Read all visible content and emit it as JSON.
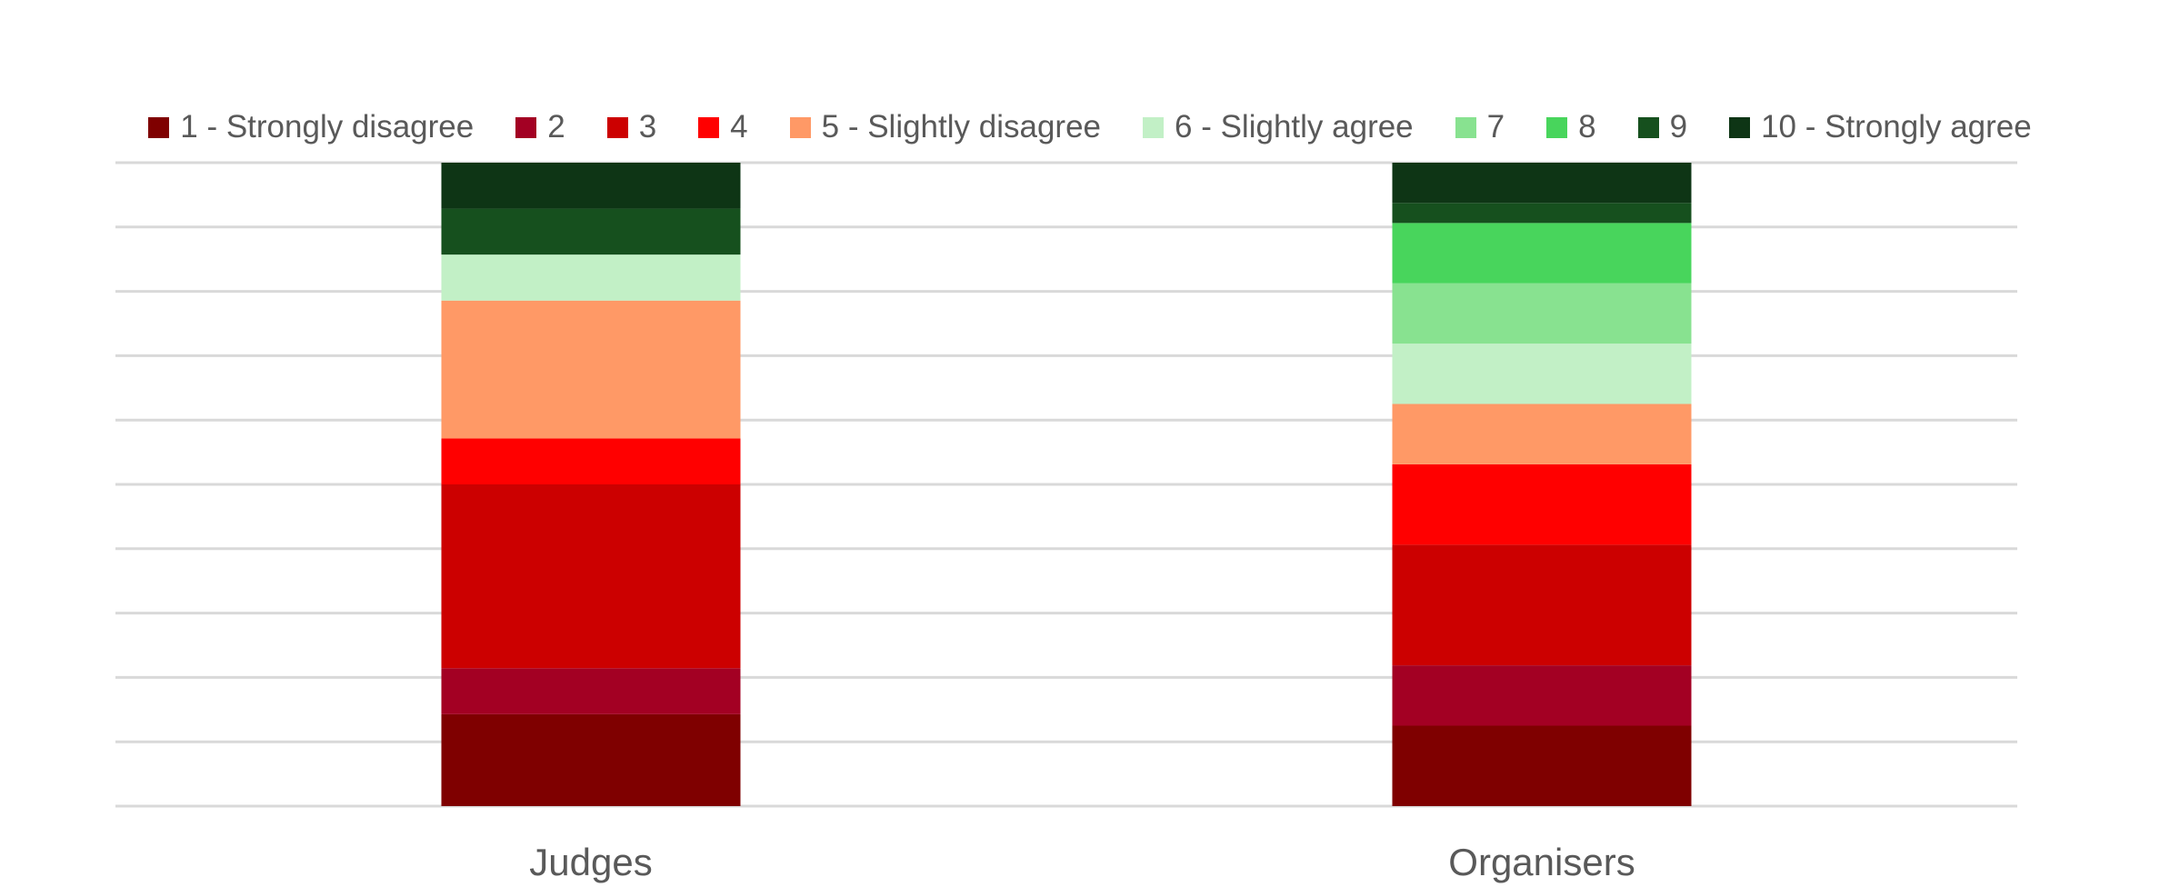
{
  "chart_data": {
    "type": "bar",
    "stacked": true,
    "normalized_percent": true,
    "title": "",
    "xlabel": "",
    "ylabel": "",
    "ylim": [
      0,
      100
    ],
    "y_gridlines_every": 10,
    "y_tick_labels_visible": false,
    "grid": true,
    "legend_position": "top",
    "categories": [
      "Judges",
      "Organisers"
    ],
    "series": [
      {
        "name": "1 - Strongly disagree",
        "color": "#7F0000",
        "values": [
          2,
          4
        ]
      },
      {
        "name": "2",
        "color": "#A30023",
        "values": [
          1,
          3
        ]
      },
      {
        "name": "3",
        "color": "#CC0000",
        "values": [
          4,
          6
        ]
      },
      {
        "name": "4",
        "color": "#FF0000",
        "values": [
          1,
          4
        ]
      },
      {
        "name": "5 - Slightly disagree",
        "color": "#FF9966",
        "values": [
          3,
          3
        ]
      },
      {
        "name": "6 - Slightly agree",
        "color": "#C2F0C6",
        "values": [
          1,
          3
        ]
      },
      {
        "name": "7",
        "color": "#88E290",
        "values": [
          0,
          3
        ]
      },
      {
        "name": "8",
        "color": "#48D55C",
        "values": [
          0,
          3
        ]
      },
      {
        "name": "9",
        "color": "#16501E",
        "values": [
          1,
          1
        ]
      },
      {
        "name": "10 - Strongly agree",
        "color": "#0E3515",
        "values": [
          1,
          2
        ]
      }
    ],
    "percent_values": {
      "Judges": [
        14.3,
        7.1,
        28.6,
        7.1,
        21.4,
        7.1,
        0,
        0,
        7.1,
        7.1
      ],
      "Organisers": [
        12.5,
        9.4,
        18.75,
        12.5,
        9.4,
        9.4,
        9.4,
        9.4,
        3.1,
        6.25
      ]
    },
    "colors": {
      "text": "#595959",
      "gridline": "#D9D9D9"
    }
  }
}
